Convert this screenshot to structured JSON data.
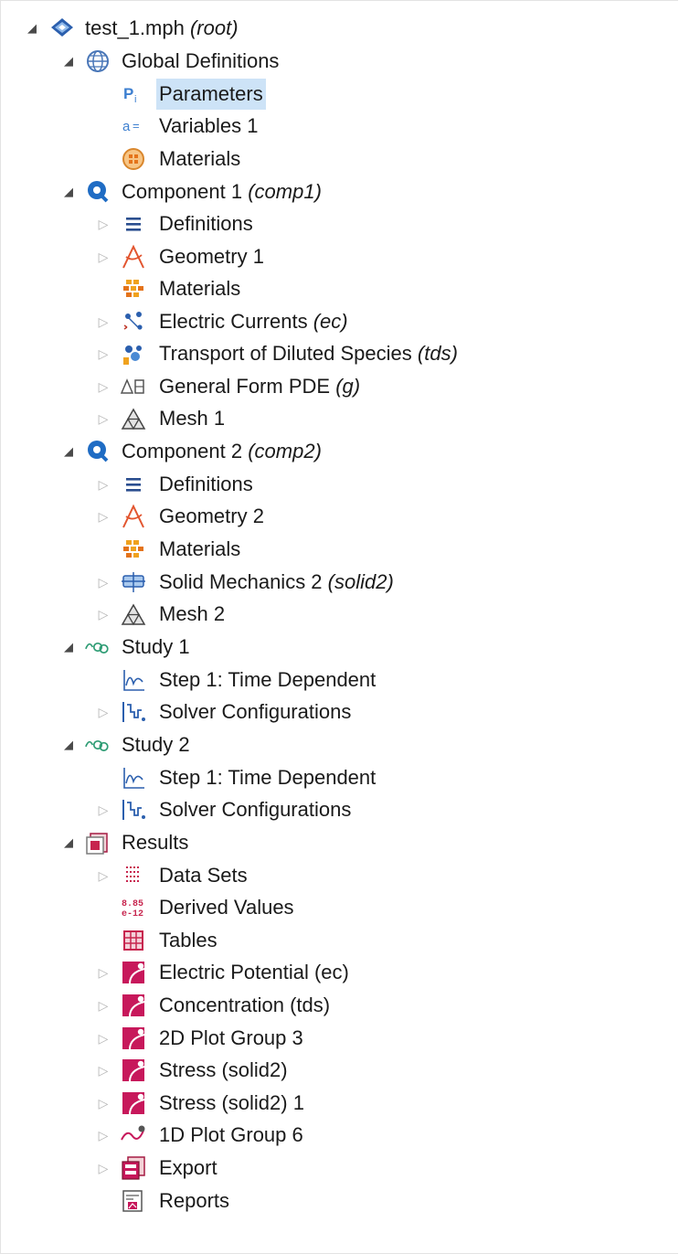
{
  "tree": {
    "nodes": [
      {
        "label": "test_1.mph",
        "tag": "(root)",
        "icon": "model-root-icon",
        "toggle": "expanded"
      },
      {
        "label": "Global Definitions",
        "tag": "",
        "icon": "global-definitions-icon",
        "toggle": "expanded"
      },
      {
        "label": "Parameters",
        "tag": "",
        "icon": "parameters-icon",
        "toggle": "none",
        "selected": true
      },
      {
        "label": "Variables 1",
        "tag": "",
        "icon": "variables-icon",
        "toggle": "none"
      },
      {
        "label": "Materials",
        "tag": "",
        "icon": "global-materials-icon",
        "toggle": "none"
      },
      {
        "label": "Component 1",
        "tag": "(comp1)",
        "icon": "component-icon",
        "toggle": "expanded"
      },
      {
        "label": "Definitions",
        "tag": "",
        "icon": "definitions-icon",
        "toggle": "collapsed"
      },
      {
        "label": "Geometry 1",
        "tag": "",
        "icon": "geometry-icon",
        "toggle": "collapsed"
      },
      {
        "label": "Materials",
        "tag": "",
        "icon": "materials-icon",
        "toggle": "none"
      },
      {
        "label": "Electric Currents",
        "tag": "(ec)",
        "icon": "electric-currents-icon",
        "toggle": "collapsed"
      },
      {
        "label": "Transport of Diluted Species",
        "tag": "(tds)",
        "icon": "transport-diluted-species-icon",
        "toggle": "collapsed"
      },
      {
        "label": "General Form PDE",
        "tag": "(g)",
        "icon": "pde-icon",
        "toggle": "collapsed"
      },
      {
        "label": "Mesh 1",
        "tag": "",
        "icon": "mesh-icon",
        "toggle": "collapsed"
      },
      {
        "label": "Component 2",
        "tag": "(comp2)",
        "icon": "component-icon",
        "toggle": "expanded"
      },
      {
        "label": "Definitions",
        "tag": "",
        "icon": "definitions-icon",
        "toggle": "collapsed"
      },
      {
        "label": "Geometry 2",
        "tag": "",
        "icon": "geometry-icon",
        "toggle": "collapsed"
      },
      {
        "label": "Materials",
        "tag": "",
        "icon": "materials-icon",
        "toggle": "none"
      },
      {
        "label": "Solid Mechanics 2",
        "tag": "(solid2)",
        "icon": "solid-mechanics-icon",
        "toggle": "collapsed"
      },
      {
        "label": "Mesh 2",
        "tag": "",
        "icon": "mesh-icon",
        "toggle": "collapsed"
      },
      {
        "label": "Study 1",
        "tag": "",
        "icon": "study-icon",
        "toggle": "expanded"
      },
      {
        "label": "Step 1: Time Dependent",
        "tag": "",
        "icon": "time-dependent-step-icon",
        "toggle": "none"
      },
      {
        "label": "Solver Configurations",
        "tag": "",
        "icon": "solver-configurations-icon",
        "toggle": "collapsed"
      },
      {
        "label": "Study 2",
        "tag": "",
        "icon": "study-icon",
        "toggle": "expanded"
      },
      {
        "label": "Step 1: Time Dependent",
        "tag": "",
        "icon": "time-dependent-step-icon",
        "toggle": "none"
      },
      {
        "label": "Solver Configurations",
        "tag": "",
        "icon": "solver-configurations-icon",
        "toggle": "collapsed"
      },
      {
        "label": "Results",
        "tag": "",
        "icon": "results-icon",
        "toggle": "expanded"
      },
      {
        "label": "Data Sets",
        "tag": "",
        "icon": "data-sets-icon",
        "toggle": "collapsed"
      },
      {
        "label": "Derived Values",
        "tag": "",
        "icon": "derived-values-icon",
        "toggle": "none"
      },
      {
        "label": "Tables",
        "tag": "",
        "icon": "tables-icon",
        "toggle": "none"
      },
      {
        "label": "Electric Potential (ec)",
        "tag": "",
        "icon": "plot-group-2d-icon",
        "toggle": "collapsed"
      },
      {
        "label": "Concentration (tds)",
        "tag": "",
        "icon": "plot-group-2d-icon",
        "toggle": "collapsed"
      },
      {
        "label": "2D Plot Group 3",
        "tag": "",
        "icon": "plot-group-2d-icon",
        "toggle": "collapsed"
      },
      {
        "label": "Stress (solid2)",
        "tag": "",
        "icon": "plot-group-2d-icon",
        "toggle": "collapsed"
      },
      {
        "label": "Stress (solid2) 1",
        "tag": "",
        "icon": "plot-group-2d-icon",
        "toggle": "collapsed"
      },
      {
        "label": "1D Plot Group 6",
        "tag": "",
        "icon": "plot-group-1d-icon",
        "toggle": "collapsed"
      },
      {
        "label": "Export",
        "tag": "",
        "icon": "export-icon",
        "toggle": "collapsed"
      },
      {
        "label": "Reports",
        "tag": "",
        "icon": "reports-icon",
        "toggle": "none"
      }
    ]
  }
}
